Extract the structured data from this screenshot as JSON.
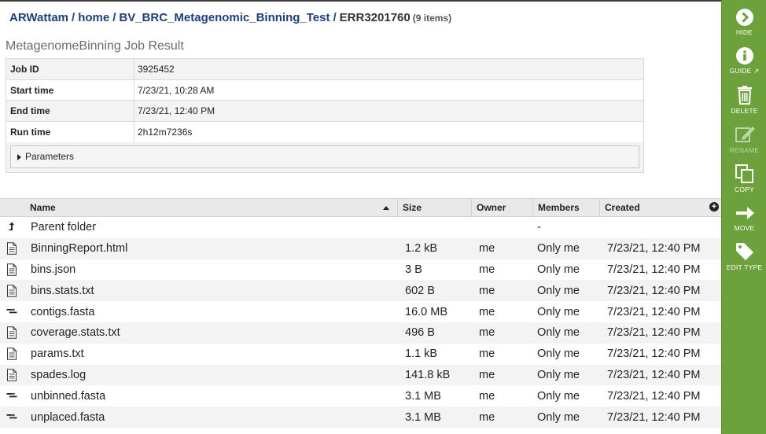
{
  "breadcrumb": {
    "items": [
      "ARWattam",
      "home",
      "BV_BRC_Metagenomic_Binning_Test"
    ],
    "current": "ERR3201760",
    "count": "(9 items)"
  },
  "job": {
    "title": "MetagenomeBinning Job Result",
    "rows": [
      {
        "key": "Job ID",
        "value": "3925452"
      },
      {
        "key": "Start time",
        "value": "7/23/21, 10:28 AM"
      },
      {
        "key": "End time",
        "value": "7/23/21, 12:40 PM"
      },
      {
        "key": "Run time",
        "value": "2h12m7236s"
      }
    ],
    "parameters_label": "Parameters"
  },
  "grid": {
    "columns": {
      "name": "Name",
      "size": "Size",
      "owner": "Owner",
      "members": "Members",
      "created": "Created"
    },
    "rows": [
      {
        "icon": "parent-folder-icon",
        "name": "Parent folder",
        "size": "",
        "owner": "",
        "members": "-",
        "created": ""
      },
      {
        "icon": "document-icon",
        "name": "BinningReport.html",
        "size": "1.2 kB",
        "owner": "me",
        "members": "Only me",
        "created": "7/23/21, 12:40 PM"
      },
      {
        "icon": "document-icon",
        "name": "bins.json",
        "size": "3 B",
        "owner": "me",
        "members": "Only me",
        "created": "7/23/21, 12:40 PM"
      },
      {
        "icon": "document-icon",
        "name": "bins.stats.txt",
        "size": "602 B",
        "owner": "me",
        "members": "Only me",
        "created": "7/23/21, 12:40 PM"
      },
      {
        "icon": "sequence-icon",
        "name": "contigs.fasta",
        "size": "16.0 MB",
        "owner": "me",
        "members": "Only me",
        "created": "7/23/21, 12:40 PM"
      },
      {
        "icon": "document-icon",
        "name": "coverage.stats.txt",
        "size": "496 B",
        "owner": "me",
        "members": "Only me",
        "created": "7/23/21, 12:40 PM"
      },
      {
        "icon": "document-icon",
        "name": "params.txt",
        "size": "1.1 kB",
        "owner": "me",
        "members": "Only me",
        "created": "7/23/21, 12:40 PM"
      },
      {
        "icon": "document-icon",
        "name": "spades.log",
        "size": "141.8 kB",
        "owner": "me",
        "members": "Only me",
        "created": "7/23/21, 12:40 PM"
      },
      {
        "icon": "sequence-icon",
        "name": "unbinned.fasta",
        "size": "3.1 MB",
        "owner": "me",
        "members": "Only me",
        "created": "7/23/21, 12:40 PM"
      },
      {
        "icon": "sequence-icon",
        "name": "unplaced.fasta",
        "size": "3.1 MB",
        "owner": "me",
        "members": "Only me",
        "created": "7/23/21, 12:40 PM"
      }
    ]
  },
  "actions": {
    "hide": "HIDE",
    "guide": "GUIDE",
    "delete": "DELETE",
    "rename": "RENAME",
    "copy": "COPY",
    "move": "MOVE",
    "edit_type": "EDIT TYPE"
  },
  "colors": {
    "sidebar": "#6da13c",
    "link": "#1f3f78"
  }
}
